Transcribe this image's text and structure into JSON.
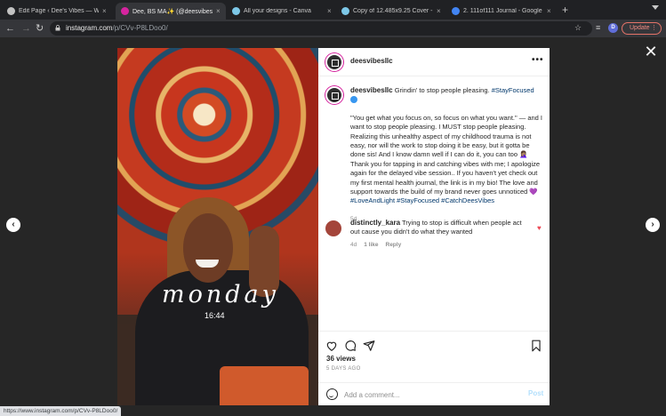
{
  "browser": {
    "tabs": [
      {
        "title": "Edit Page ‹ Dee's Vibes — Wo",
        "favicon_color": "#c2c2c2",
        "active": false
      },
      {
        "title": "Dee, BS MA✨ (@deesvibesllc",
        "favicon_color": "#d6249f",
        "active": true
      },
      {
        "title": "All your designs - Canva",
        "favicon_color": "#7dc8e8",
        "active": false
      },
      {
        "title": "Copy of 12.485x9.25 Cover - \\",
        "favicon_color": "#7dc8e8",
        "active": false
      },
      {
        "title": "2. 111of111 Journal - Google D",
        "favicon_color": "#4285f4",
        "active": false
      }
    ],
    "close_glyph": "×",
    "new_tab_glyph": "+",
    "url_host": "instagram.com",
    "url_path": "/p/CVv-P8LDoo0/",
    "profile_initial": "D",
    "update_label": "Update",
    "status_url": "https://www.instagram.com/p/CVv-P8LDoo0/"
  },
  "post": {
    "photo": {
      "overlay_day": "monday",
      "overlay_time": "16:44"
    },
    "author": "deesvibesllc",
    "caption_line": "Grindin' to stop people pleasing.",
    "caption_tag": "#StayFocused",
    "caption_body": "\"You get what you focus on, so focus on what you want.\" — and I want to stop people pleasing. I MUST stop people pleasing. Realizing this unhealthy aspect of my childhood trauma is not easy, nor will the work to stop doing it be easy, but it gotta be done sis! And I know damn well if I can do it, you can too 🤦🏽‍♀️ Thank you for tapping in and catching vibes with me; I apologize again for the delayed vibe session.. If you haven't yet check out my first mental health journal, the link is in my bio! The love and support towards the build of my brand never goes unnoticed 💜",
    "caption_tags_end": "#LoveAndLight #StayFocused #CatchDeesVibes",
    "caption_age": "5d",
    "comment": {
      "user": "distinctly_kara",
      "text": "Trying to stop is difficult when people act out cause you didn't do what they wanted",
      "age": "4d",
      "likes": "1 like",
      "reply_label": "Reply"
    },
    "views": "36 views",
    "time_ago": "5 DAYS AGO",
    "add_comment_placeholder": "Add a comment...",
    "post_label": "Post",
    "more_glyph": "•••",
    "close_glyph": "✕",
    "prev_glyph": "‹",
    "next_glyph": "›"
  }
}
